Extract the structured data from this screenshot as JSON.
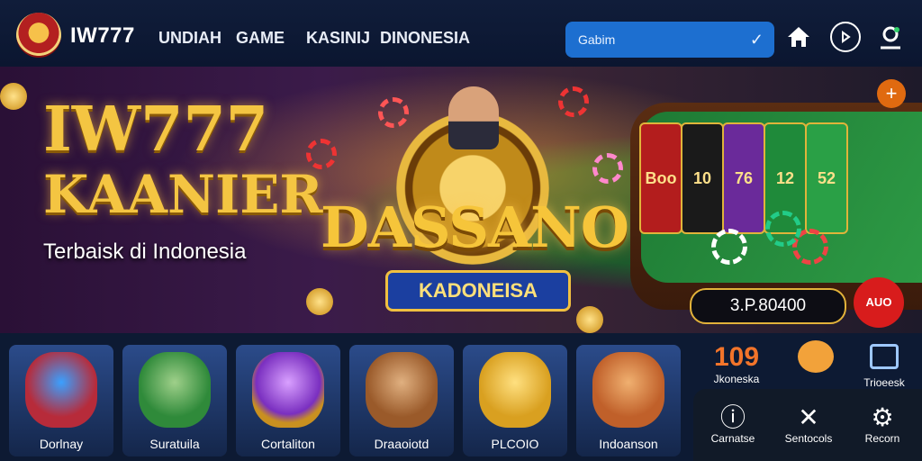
{
  "header": {
    "brand": "IW777",
    "nav": [
      "UNDIAH",
      "GAME",
      "KASINIJ",
      "DINONESIA"
    ],
    "search_value": "Gabim",
    "icons": [
      "home-icon",
      "play-icon",
      "user-icon"
    ]
  },
  "hero": {
    "title_line1": "IW777",
    "title_line2": "KAANIER",
    "subtitle": "Terbaisk di Indonesia",
    "center_title": "DASSANO",
    "center_badge": "KADONEISA",
    "reels": [
      "Boo",
      "10",
      "76",
      "12",
      "52"
    ],
    "amount": "3.P.80400",
    "add_button": "AUO",
    "plus_button": "+"
  },
  "games": [
    {
      "label": "Dorlnay",
      "art": "gift-box-icon",
      "color": "#b72b3a"
    },
    {
      "label": "Suratuila",
      "art": "wolf-icon",
      "color": "#2f8a3a"
    },
    {
      "label": "Cortaliton",
      "art": "crystal-ball-icon",
      "color": "#7a2fc0"
    },
    {
      "label": "Draaoiotd",
      "art": "beaver-cowboy-icon",
      "color": "#9a5a2a"
    },
    {
      "label": "PLCOIO",
      "art": "treasure-chest-icon",
      "color": "#d9a020"
    },
    {
      "label": "Indoanson",
      "art": "fox-cowboy-icon",
      "color": "#c0602a"
    }
  ],
  "stats": [
    {
      "value": "109",
      "label": "Jkoneska",
      "icon": ""
    },
    {
      "value": "",
      "label": "",
      "icon": "chat-bubble-icon"
    },
    {
      "value": "",
      "label": "Trioeesk",
      "icon": "document-icon"
    }
  ],
  "panel": [
    {
      "label": "Carnatse",
      "icon": "info-shield-icon"
    },
    {
      "label": "Sentocols",
      "icon": "close-icon"
    },
    {
      "label": "Recorn",
      "icon": "gear-icon"
    }
  ],
  "colors": {
    "accent": "#1d6fd0",
    "gold": "#f4c542",
    "danger": "#d81c1c"
  }
}
